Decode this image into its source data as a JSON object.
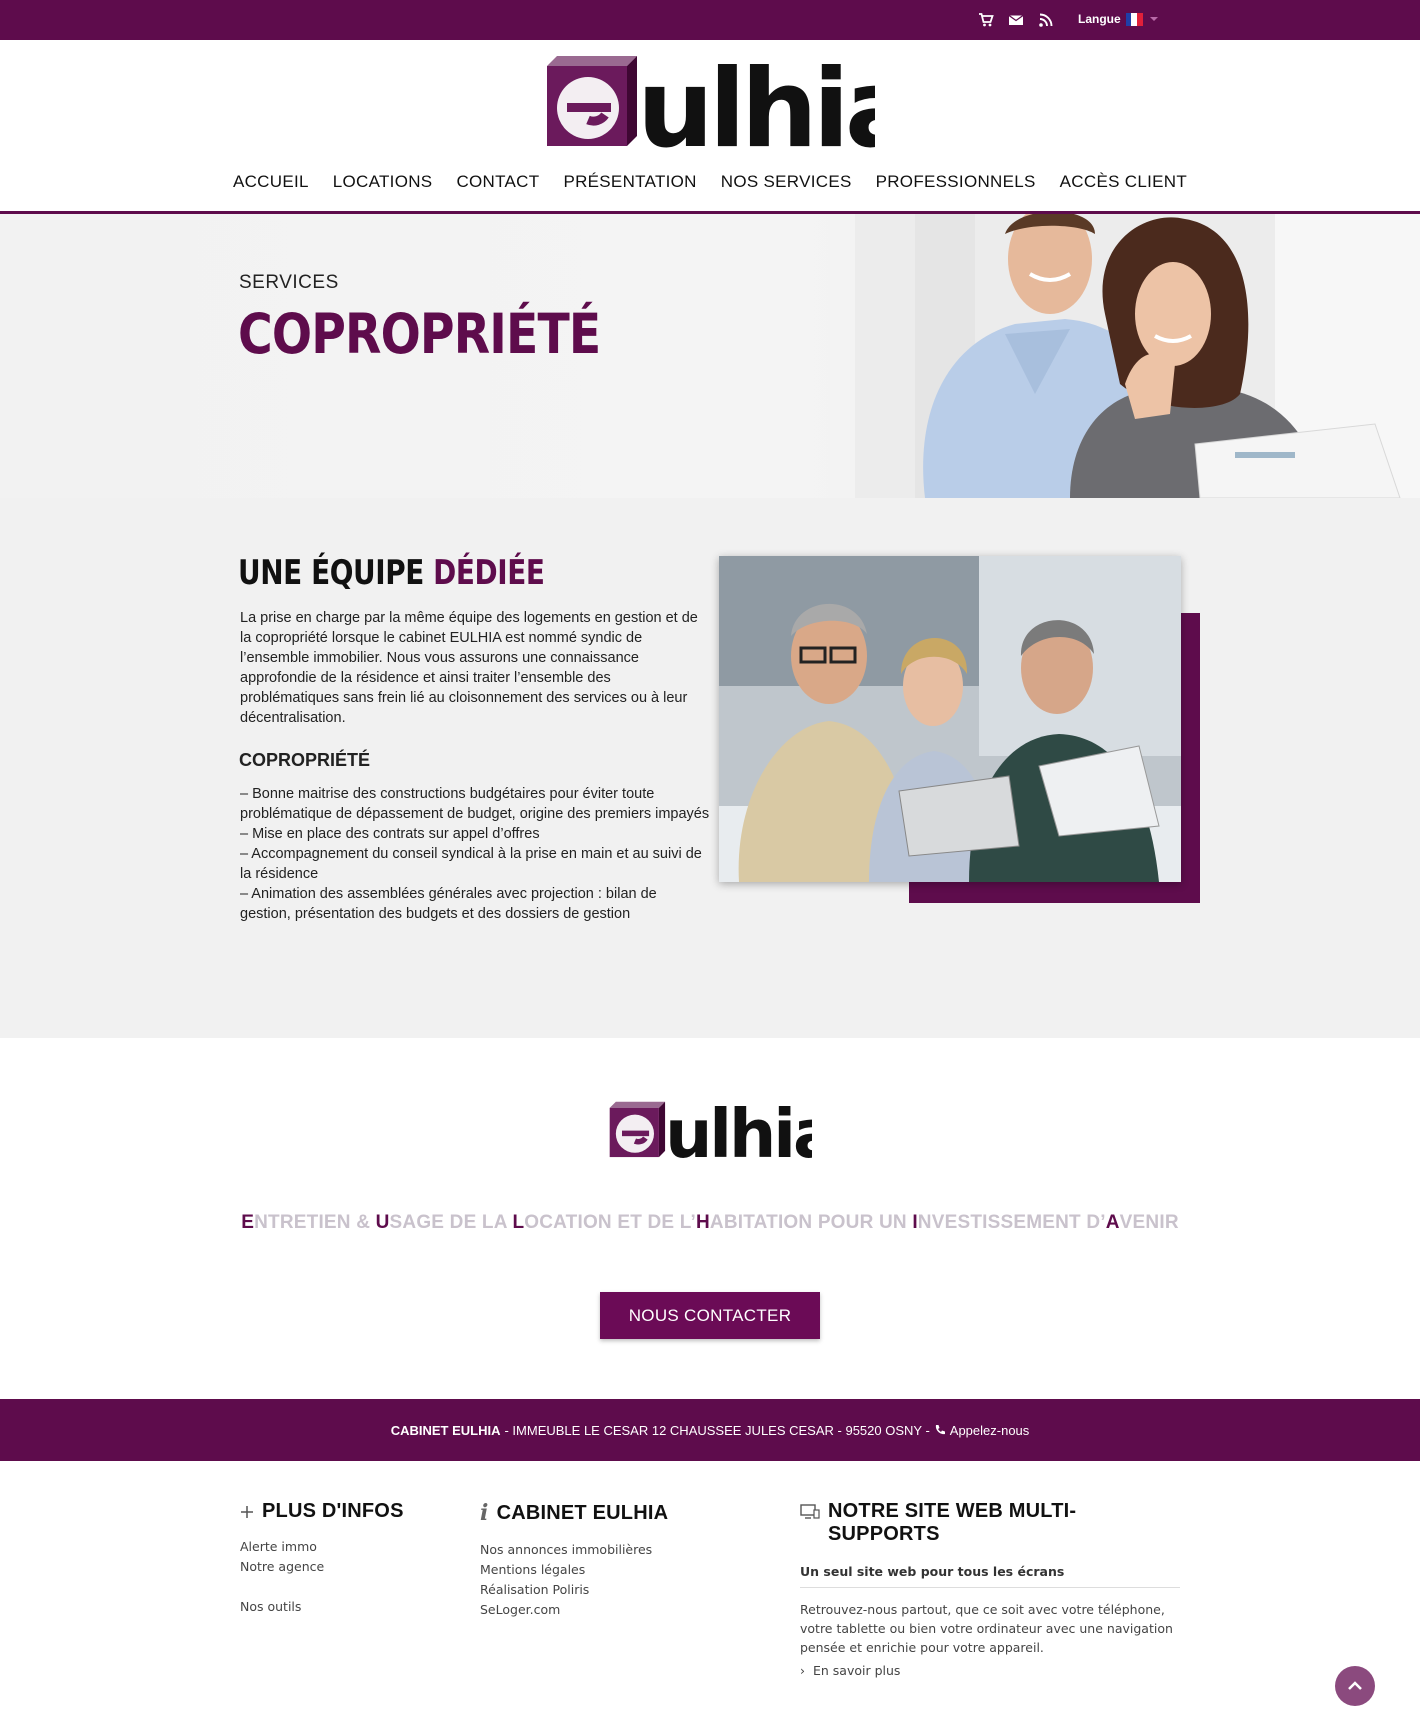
{
  "topbar": {
    "icons": [
      "cart-icon",
      "mail-icon",
      "rss-icon"
    ],
    "language_label": "Langue"
  },
  "brand": {
    "logo_text": "eulhia",
    "colors": {
      "primary": "#5e0c4c",
      "accent_light": "#c9c2cc",
      "background": "#f1f1f1"
    }
  },
  "nav": {
    "items": [
      {
        "label": "ACCUEIL"
      },
      {
        "label": "LOCATIONS"
      },
      {
        "label": "CONTACT"
      },
      {
        "label": "PRÉSENTATION"
      },
      {
        "label": "NOS SERVICES"
      },
      {
        "label": "PROFESSIONNELS"
      },
      {
        "label": "ACCÈS CLIENT"
      }
    ]
  },
  "hero": {
    "kicker": "SERVICES",
    "title": "COPROPRIÉTÉ"
  },
  "content": {
    "heading_main": "UNE ÉQUIPE",
    "heading_accent": "DÉDIÉE",
    "paragraph": "La prise en charge par la même équipe des logements en gestion et de la copropriété lorsque le cabinet EULHIA est nommé syndic de l’ensemble immobilier. Nous vous assurons une connaissance approfondie de la résidence et ainsi traiter l’ensemble des problématiques sans frein lié au cloisonnement des services ou à leur décentralisation.",
    "subheading": "COPROPRIÉTÉ",
    "list": [
      "– Bonne maitrise des constructions budgétaires pour éviter toute problématique de dépassement de budget, origine des premiers impayés",
      "– Mise en place des contrats sur appel d’offres",
      "– Accompagnement du conseil syndical à la prise en main et au suivi de la résidence",
      "– Animation des assemblées générales avec projection : bilan de gestion, présentation des budgets et des dossiers de gestion"
    ]
  },
  "cta": {
    "acronym": [
      {
        "letter": "E",
        "rest": "NTRETIEN & "
      },
      {
        "letter": "U",
        "rest": "SAGE DE LA "
      },
      {
        "letter": "L",
        "rest": "OCATION ET DE L’"
      },
      {
        "letter": "H",
        "rest": "ABITATION POUR UN "
      },
      {
        "letter": "I",
        "rest": "NVESTISSEMENT D’"
      },
      {
        "letter": "A",
        "rest": "VENIR"
      }
    ],
    "button_label": "NOUS CONTACTER"
  },
  "address": {
    "name": "CABINET EULHIA",
    "details": "- IMMEUBLE LE CESAR 12 CHAUSSEE JULES CESAR - 95520 OSNY -",
    "call_label": "Appelez-nous"
  },
  "footer": {
    "col1": {
      "title": "PLUS D'INFOS",
      "items": [
        "Alerte immo",
        "Notre agence",
        "",
        "Nos outils"
      ]
    },
    "col2": {
      "title": "CABINET EULHIA",
      "items": [
        "Nos annonces immobilières",
        "Mentions légales",
        "Réalisation Poliris",
        "SeLoger.com"
      ]
    },
    "col3": {
      "title": "NOTRE SITE WEB MULTI-SUPPORTS",
      "subtitle": "Un seul site web pour tous les écrans",
      "description": "Retrouvez-nous partout, que ce soit avec votre téléphone, votre tablette ou bien votre ordinateur avec une navigation pensée et enrichie pour votre appareil.",
      "more_label": "En savoir plus"
    }
  }
}
